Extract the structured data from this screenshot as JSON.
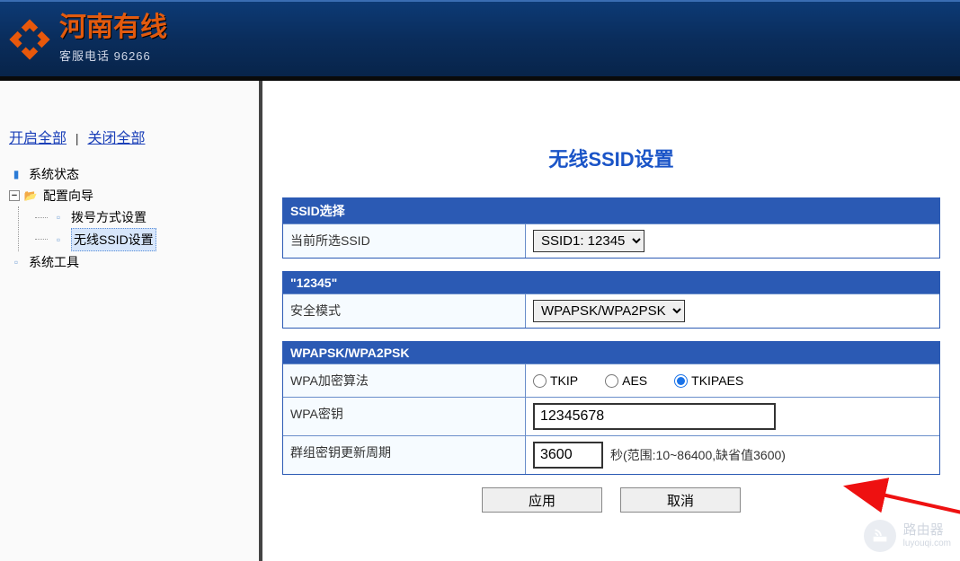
{
  "brand": {
    "name": "河南有线",
    "subtitle": "客服电话  96266"
  },
  "sidebar": {
    "expand_all": "开启全部",
    "collapse_all": "关闭全部",
    "items": [
      {
        "label": "系统状态"
      },
      {
        "label": "配置向导",
        "children": [
          {
            "label": "拨号方式设置"
          },
          {
            "label": "无线SSID设置",
            "selected": true
          }
        ]
      },
      {
        "label": "系统工具"
      }
    ]
  },
  "main": {
    "title": "无线SSID设置",
    "ssid_panel": {
      "header": "SSID选择",
      "current_label": "当前所选SSID",
      "current_value": "SSID1: 12345"
    },
    "security_panel": {
      "header": "\"12345\"",
      "mode_label": "安全模式",
      "mode_value": "WPAPSK/WPA2PSK"
    },
    "wpa_panel": {
      "header": "WPAPSK/WPA2PSK",
      "algo_label": "WPA加密算法",
      "algo_options": {
        "tkip": "TKIP",
        "aes": "AES",
        "tkipaes": "TKIPAES"
      },
      "algo_selected": "tkipaes",
      "key_label": "WPA密钥",
      "key_value": "12345678",
      "rekey_label": "群组密钥更新周期",
      "rekey_value": "3600",
      "rekey_note": "秒(范围:10~86400,缺省值3600)"
    },
    "actions": {
      "apply": "应用",
      "cancel": "取消"
    }
  },
  "watermark": {
    "title": "路由器",
    "sub": "luyouqi.com"
  }
}
